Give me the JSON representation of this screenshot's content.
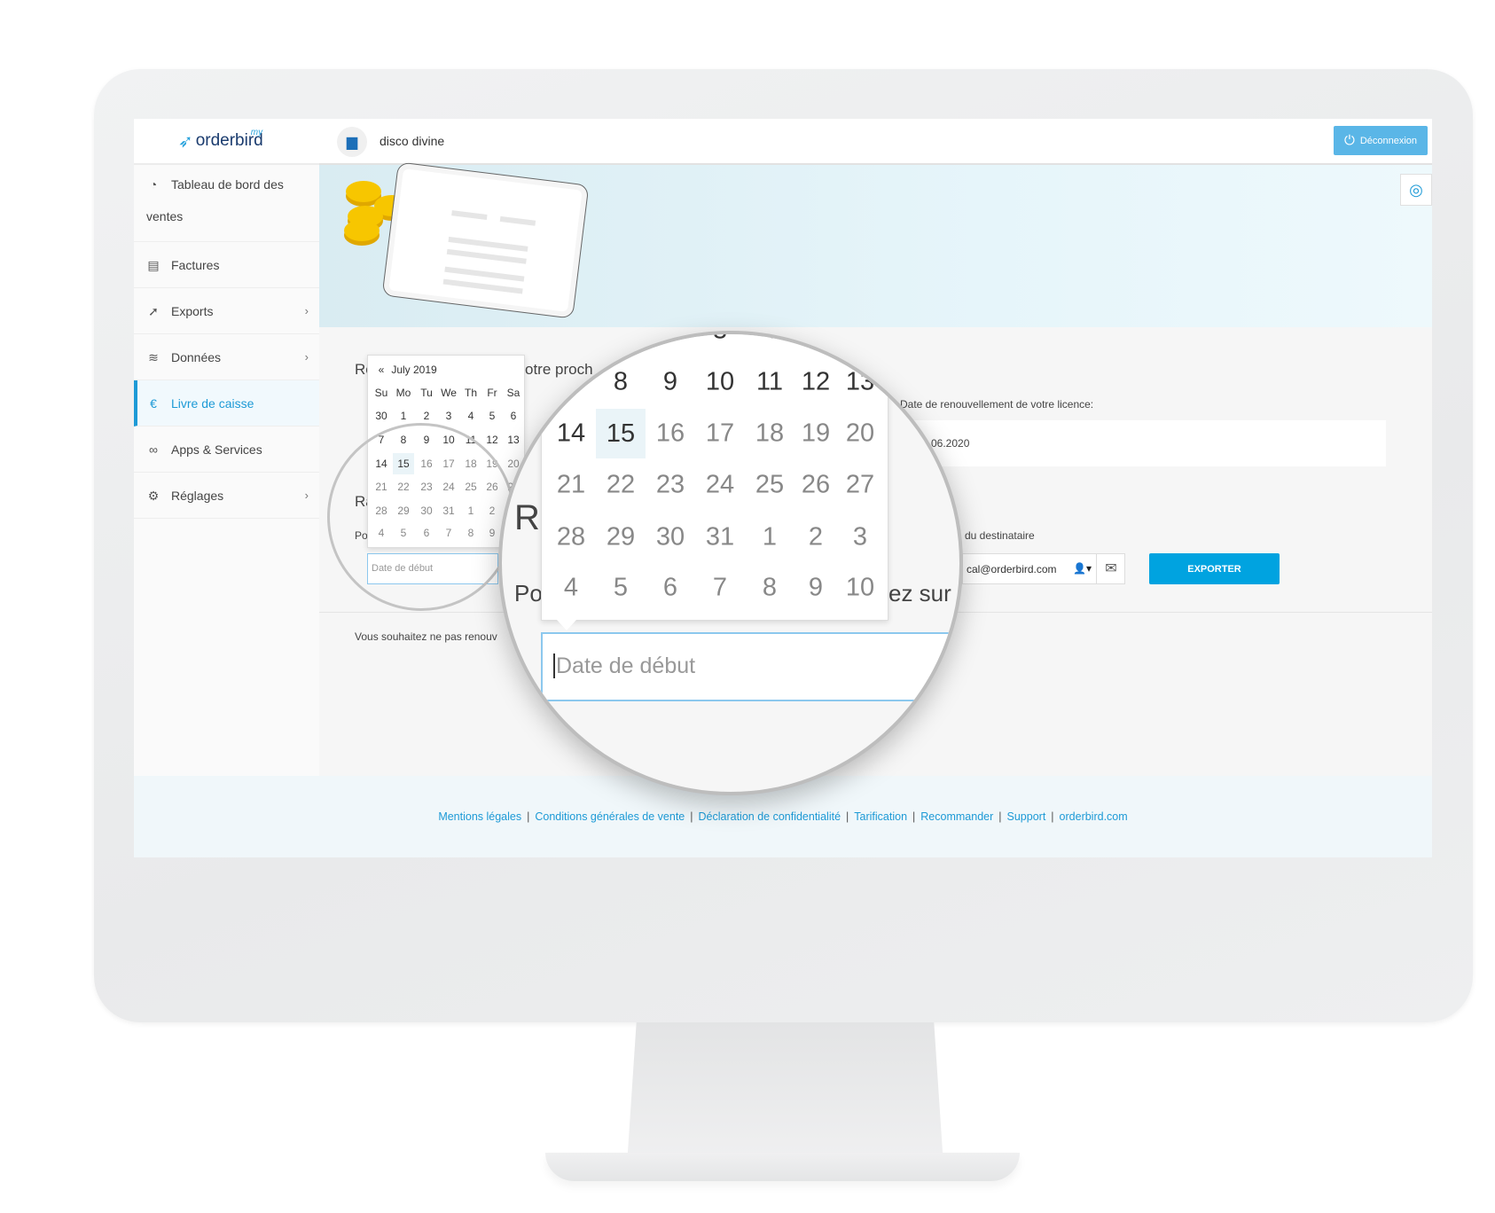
{
  "app": {
    "logo": "orderbird",
    "logo_prefix": "my",
    "store_name": "disco divine",
    "logout_label": "Déconnexion"
  },
  "sidebar": {
    "items": [
      {
        "label": "Tableau de bord des ventes",
        "icon": "gauge-icon"
      },
      {
        "label": "Factures",
        "icon": "document-icon"
      },
      {
        "label": "Exports",
        "icon": "export-icon",
        "chevron": "›"
      },
      {
        "label": "Données",
        "icon": "layers-icon",
        "chevron": "›"
      },
      {
        "label": "Livre de caisse",
        "icon": "cashbook-icon",
        "active": true
      },
      {
        "label": "Apps & Services",
        "icon": "rings-icon"
      },
      {
        "label": "Réglages",
        "icon": "gear-icon",
        "chevron": "›"
      }
    ]
  },
  "main": {
    "heading_fragment_left": "Re",
    "heading_fragment_right": "otre proch",
    "section2_fragment": "Ra",
    "para_fragment": "Po",
    "renewal_label": "Date de renouvellement de votre licence:",
    "renewal_value": "06.2020",
    "recipient_label": "du destinataire",
    "email_value": "cal@orderbird.com",
    "export_label": "EXPORTER",
    "start_date_placeholder": "Date de début",
    "cancel_text": "Vous souhaitez ne pas renouv",
    "magnified_fragment": "ez sur '"
  },
  "calendar": {
    "prev_label": "«",
    "month": "July 2019",
    "weekdays": [
      "Su",
      "Mo",
      "Tu",
      "We",
      "Th",
      "Fr",
      "Sa"
    ],
    "weeks": [
      [
        "30",
        "1",
        "2",
        "3",
        "4",
        "5",
        "6"
      ],
      [
        "7",
        "8",
        "9",
        "10",
        "11",
        "12",
        "13"
      ],
      [
        "14",
        "15",
        "16",
        "17",
        "18",
        "19",
        "20"
      ],
      [
        "21",
        "22",
        "23",
        "24",
        "25",
        "26",
        "27"
      ],
      [
        "28",
        "29",
        "30",
        "31",
        "1",
        "2",
        "3"
      ],
      [
        "4",
        "5",
        "6",
        "7",
        "8",
        "9",
        "10"
      ]
    ],
    "selected": "15"
  },
  "footer": {
    "links": [
      "Mentions légales",
      "Conditions générales de vente",
      "Déclaration de confidentialité",
      "Tarification",
      "Recommander",
      "Support",
      "orderbird.com"
    ]
  },
  "colors": {
    "accent": "#1d9ad6",
    "button": "#00a3e0",
    "logout": "#5ab6e7"
  }
}
